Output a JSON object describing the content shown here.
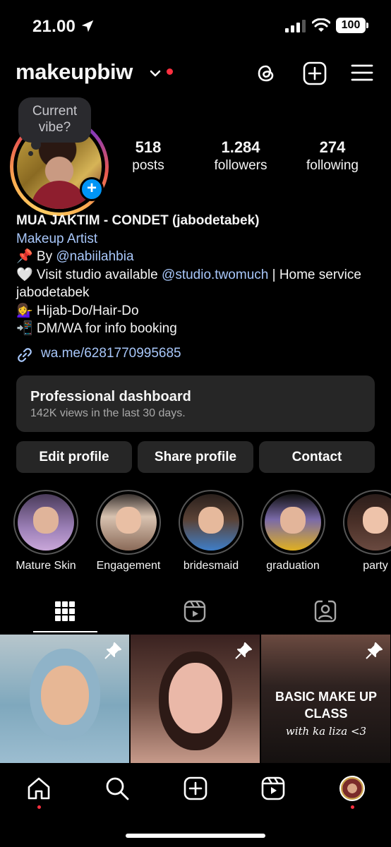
{
  "status_bar": {
    "time": "21.00",
    "battery": "100"
  },
  "header": {
    "username": "makeupbiw"
  },
  "note": {
    "text": "Current vibe?"
  },
  "stats": [
    {
      "value": "518",
      "label": "posts"
    },
    {
      "value": "1.284",
      "label": "followers"
    },
    {
      "value": "274",
      "label": "following"
    }
  ],
  "bio": {
    "name": "MUA JAKTIM - CONDET (jabodetabek)",
    "category": "Makeup Artist",
    "line1_prefix": "📌 By ",
    "line1_mention": "@nabiilahbia",
    "line2_prefix": "🤍 Visit studio available ",
    "line2_mention": "@studio.twomuch",
    "line2_suffix": " | Home service jabodetabek",
    "line3": "💁‍♀️ Hijab-Do/Hair-Do",
    "line4": "📲 DM/WA for info booking",
    "link": "wa.me/6281770995685"
  },
  "dashboard": {
    "title": "Professional dashboard",
    "subtitle": "142K views in the last 30 days."
  },
  "buttons": {
    "edit": "Edit profile",
    "share": "Share profile",
    "contact": "Contact"
  },
  "highlights": [
    {
      "label": "Mature Skin"
    },
    {
      "label": "Engagement"
    },
    {
      "label": "bridesmaid"
    },
    {
      "label": "graduation"
    },
    {
      "label": "party"
    }
  ],
  "posts": [
    {
      "pinned": true
    },
    {
      "pinned": true
    },
    {
      "pinned": true,
      "title": "BASIC MAKE UP CLASS",
      "subtitle": "with ka liza <3"
    }
  ],
  "colors": {
    "accent": "#0095f6",
    "link": "#a8c7fa",
    "notification": "#ff3040",
    "surface": "#262626"
  }
}
